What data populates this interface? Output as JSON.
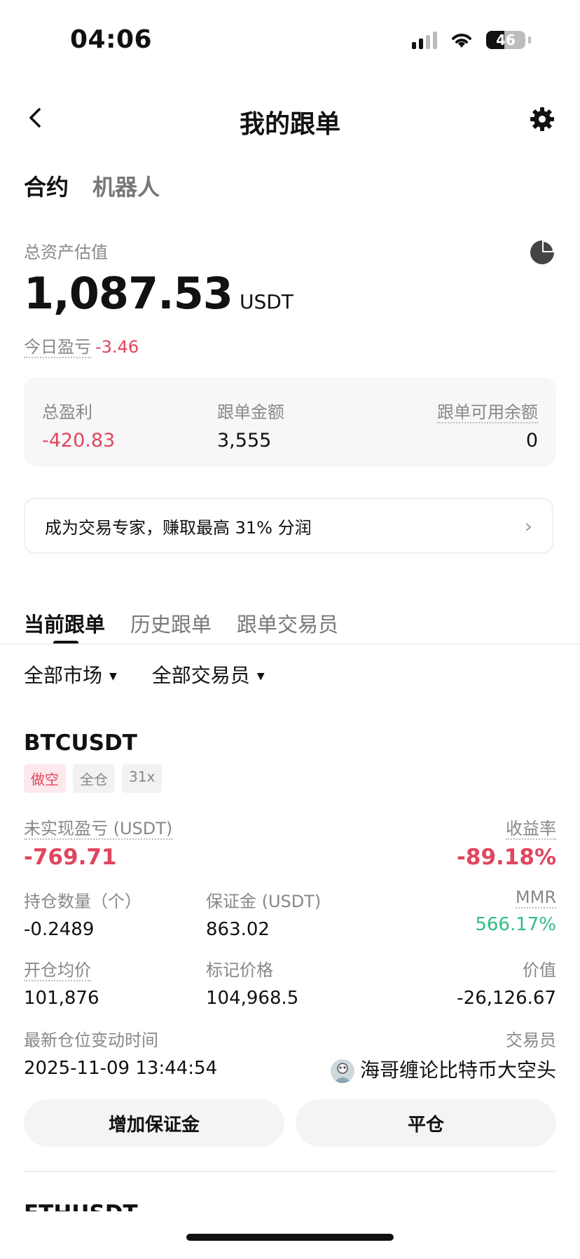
{
  "status_bar": {
    "time": "04:06",
    "battery": "46"
  },
  "nav": {
    "title": "我的跟单"
  },
  "top_tabs": [
    {
      "label": "合约"
    },
    {
      "label": "机器人"
    }
  ],
  "assets": {
    "label": "总资产估值",
    "value": "1,087.53",
    "unit": "USDT",
    "today_label": "今日盈亏",
    "today_value": "-3.46"
  },
  "summary": {
    "total_profit_label": "总盈利",
    "total_profit_value": "-420.83",
    "copy_amount_label": "跟单金额",
    "copy_amount_value": "3,555",
    "available_label": "跟单可用余额",
    "available_value": "0"
  },
  "banner": {
    "text": "成为交易专家，赚取最高 31% 分润"
  },
  "section_tabs": [
    {
      "label": "当前跟单"
    },
    {
      "label": "历史跟单"
    },
    {
      "label": "跟单交易员"
    }
  ],
  "filters": {
    "market": "全部市场",
    "trader": "全部交易员"
  },
  "position": {
    "symbol": "BTCUSDT",
    "tags": [
      "做空",
      "全仓",
      "31x"
    ],
    "unrealized_label": "未实现盈亏 (USDT)",
    "unrealized_value": "-769.71",
    "roi_label": "收益率",
    "roi_value": "-89.18%",
    "qty_label": "持仓数量（个）",
    "qty_value": "-0.2489",
    "margin_label": "保证金 (USDT)",
    "margin_value": "863.02",
    "mmr_label": "MMR",
    "mmr_value": "566.17%",
    "entry_label": "开仓均价",
    "entry_value": "101,876",
    "mark_label": "标记价格",
    "mark_value": "104,968.5",
    "value_label": "价值",
    "value_value": "-26,126.67",
    "time_label": "最新仓位变动时间",
    "time_value": "2025-11-09 13:44:54",
    "trader_label": "交易员",
    "trader_value": "海哥缠论比特币大空头",
    "add_margin_button": "增加保证金",
    "close_button": "平仓"
  },
  "next_position": {
    "symbol": "ETHUSDT"
  },
  "colors": {
    "loss": "#e0455e",
    "gain": "#2ebd85"
  }
}
